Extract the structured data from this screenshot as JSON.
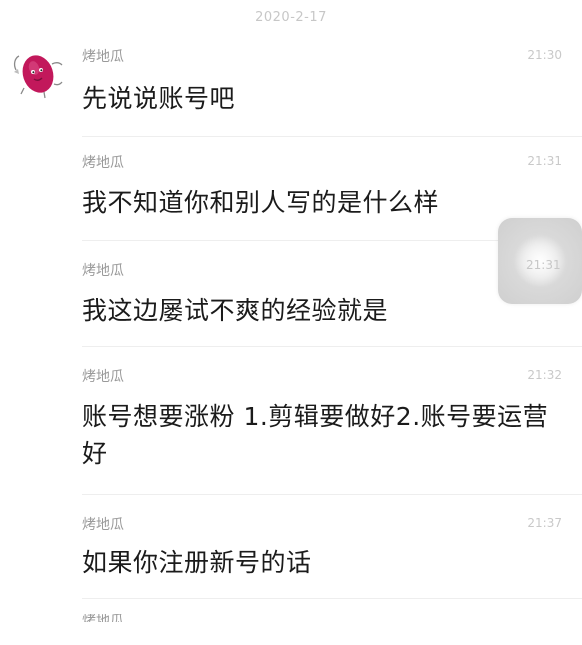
{
  "date_header": "2020-2-17",
  "contact_name": "烤地瓜",
  "messages": [
    {
      "sender": "烤地瓜",
      "time": "21:30",
      "text": "先说说账号吧"
    },
    {
      "sender": "烤地瓜",
      "time": "21:31",
      "text": "我不知道你和别人写的是什么样"
    },
    {
      "sender": "烤地瓜",
      "time": "21:31",
      "text": "我这边屡试不爽的经验就是"
    },
    {
      "sender": "烤地瓜",
      "time": "21:32",
      "text": "账号想要涨粉 1.剪辑要做好2.账号要运营好"
    },
    {
      "sender": "烤地瓜",
      "time": "21:37",
      "text": "如果你注册新号的话"
    }
  ],
  "partial_next_sender": "烤地瓜",
  "colors": {
    "background": "#ffffff",
    "text": "#1b1b1b",
    "sender": "#9a9a9a",
    "time": "#c9c9c9",
    "avatar_accent": "#c2185b"
  },
  "icons": {
    "avatar": "sweet-potato-avatar-icon",
    "floating": "assistive-touch-icon"
  }
}
